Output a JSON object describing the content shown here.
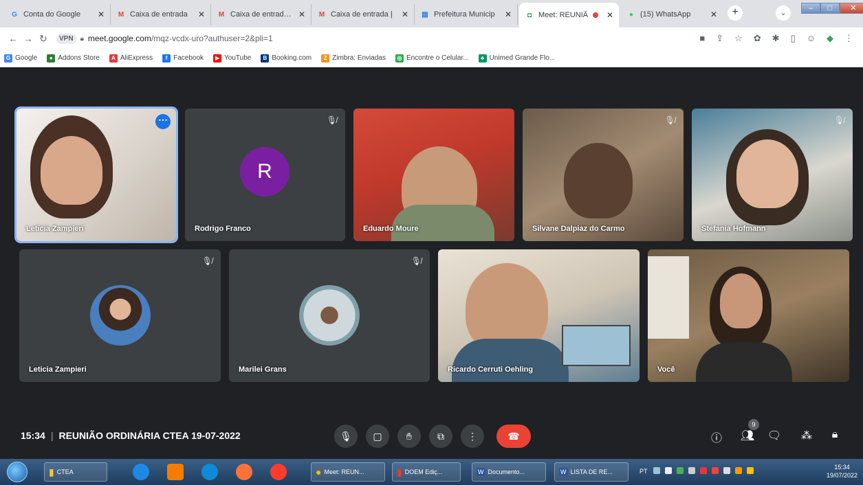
{
  "browser": {
    "tabs": [
      {
        "title": "Conta do Google",
        "favicon": "G",
        "color": "#4285f4"
      },
      {
        "title": "Caixa de entrada",
        "favicon": "M",
        "color": "#ea4335"
      },
      {
        "title": "Caixa de entrada |",
        "favicon": "M",
        "color": "#ea4335"
      },
      {
        "title": "Caixa de entrada |",
        "favicon": "M",
        "color": "#ea4335"
      },
      {
        "title": "Prefeitura Municip",
        "favicon": "▤",
        "color": "#1a73e8"
      },
      {
        "title": "Meet: REUNIÃ",
        "favicon": "◘",
        "color": "#00832d",
        "active": true
      },
      {
        "title": "(15) WhatsApp",
        "favicon": "●",
        "color": "#25d366"
      }
    ],
    "url_host": "meet.google.com",
    "url_path": "/mqz-vcdx-uro?authuser=2&pli=1",
    "vpn_label": "VPN",
    "bookmarks": [
      {
        "label": "Google",
        "icon": "G",
        "color": "#4285f4"
      },
      {
        "label": "Addons Store",
        "icon": "●",
        "color": "#2e7d32"
      },
      {
        "label": "AliExpress",
        "icon": "A",
        "color": "#e53935"
      },
      {
        "label": "Facebook",
        "icon": "f",
        "color": "#1877f2"
      },
      {
        "label": "YouTube",
        "icon": "▶",
        "color": "#ff0000"
      },
      {
        "label": "Booking.com",
        "icon": "B",
        "color": "#003580"
      },
      {
        "label": "Zimbra: Enviadas",
        "icon": "Z",
        "color": "#f7931e"
      },
      {
        "label": "Encontre o Celular...",
        "icon": "◎",
        "color": "#34a853"
      },
      {
        "label": "Unimed Grande Flo...",
        "icon": "♣",
        "color": "#00995d"
      }
    ]
  },
  "participants": [
    {
      "name": "Leticia Zampieri",
      "muted": false,
      "active": true
    },
    {
      "name": "Rodrigo Franco",
      "muted": true,
      "initial": "R"
    },
    {
      "name": "Eduardo Moure",
      "muted": false
    },
    {
      "name": "Silvane Dalpiaz do Carmo",
      "muted": true
    },
    {
      "name": "Stefania Hofmann",
      "muted": true
    },
    {
      "name": "Leticia Zampieri",
      "muted": true
    },
    {
      "name": "Marilei Grans",
      "muted": true
    },
    {
      "name": "Ricardo Cerruti Oehling",
      "muted": false
    },
    {
      "name": "Você",
      "muted": false
    }
  ],
  "meeting": {
    "time": "15:34",
    "separator": "|",
    "title": "REUNIÃO ORDINÁRIA CTEA 19-07-2022",
    "people_count": "9"
  },
  "taskbar": {
    "items": [
      {
        "label": "CTEA"
      },
      {
        "label": "Meet: REUN..."
      },
      {
        "label": "DOEM Ediç..."
      },
      {
        "label": "Documento..."
      },
      {
        "label": "LISTA DE RE..."
      }
    ],
    "lang": "PT",
    "time": "15:34",
    "date": "19/07/2022"
  }
}
